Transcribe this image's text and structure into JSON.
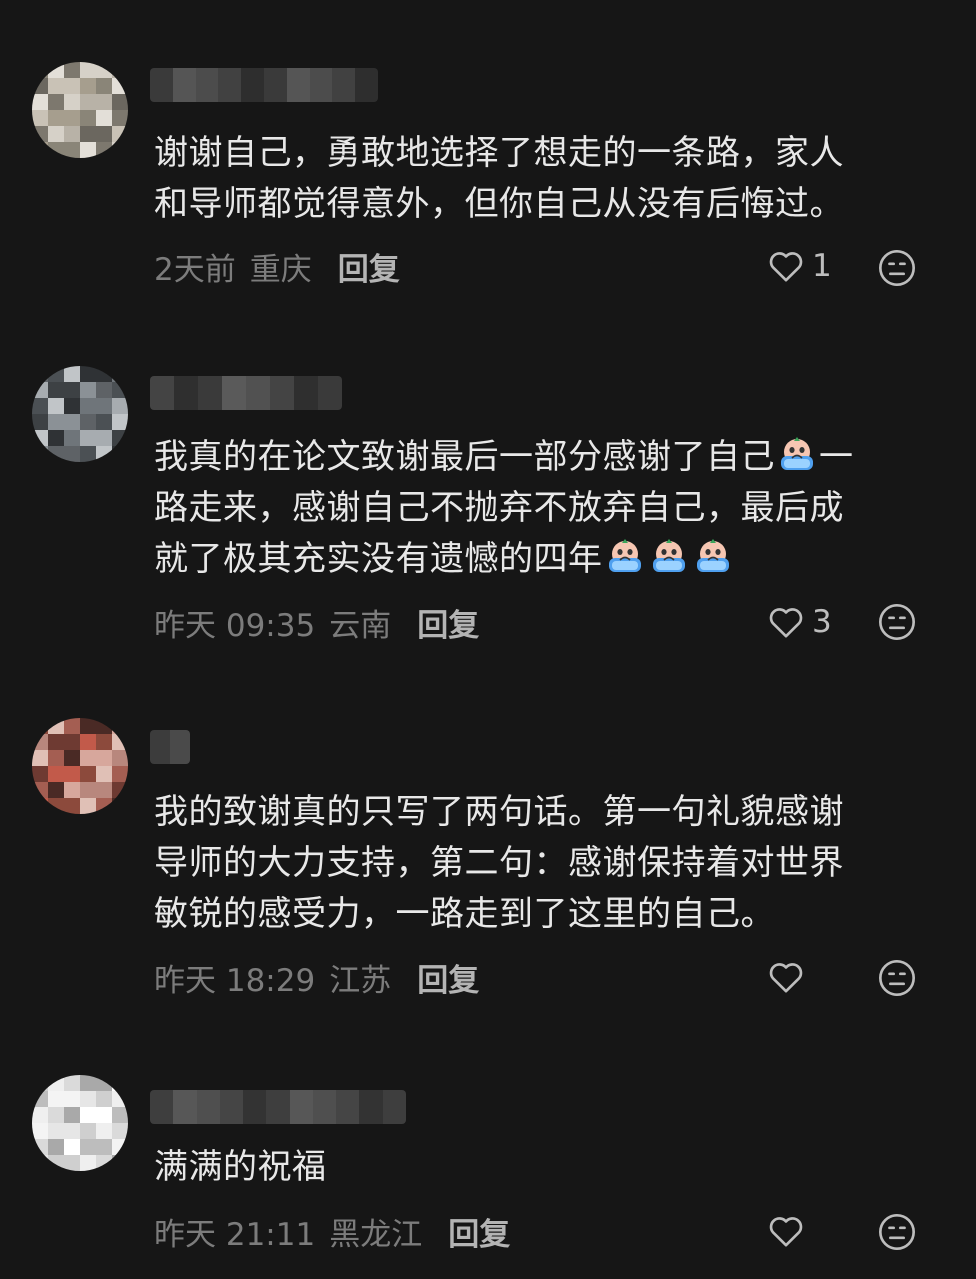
{
  "comments": [
    {
      "text": "谢谢自己，勇敢地选择了想走的一条路，家人\n和导师都觉得意外，但你自己从没有后悔过。",
      "time": "2天前",
      "location": "重庆",
      "reply_label": "回复",
      "like_count": "1"
    },
    {
      "text_parts": [
        "我真的在论文致谢最后一部分感谢了自己",
        "一\n路走来，感谢自己不抛弃不放弃自己，最后成\n就了极其充实没有遗憾的四年"
      ],
      "emoji": "crying-emoji",
      "time": "昨天 09:35",
      "location": "云南",
      "reply_label": "回复",
      "like_count": "3"
    },
    {
      "text": "我的致谢真的只写了两句话。第一句礼貌感谢\n导师的大力支持，第二句：感谢保持着对世界\n敏锐的感受力，一路走到了这里的自己。",
      "time": "昨天 18:29",
      "location": "江苏",
      "reply_label": "回复",
      "like_count": ""
    },
    {
      "text": "满满的祝福",
      "time": "昨天 21:11",
      "location": "黑龙江",
      "reply_label": "回复",
      "like_count": ""
    }
  ],
  "icons": {
    "like": "heart-outline-icon",
    "dislike": "meh-face-icon"
  },
  "colors": {
    "background": "#161616",
    "text": "#e8e8e8",
    "meta": "#7c7c7c",
    "icon": "#bdbdbd"
  }
}
